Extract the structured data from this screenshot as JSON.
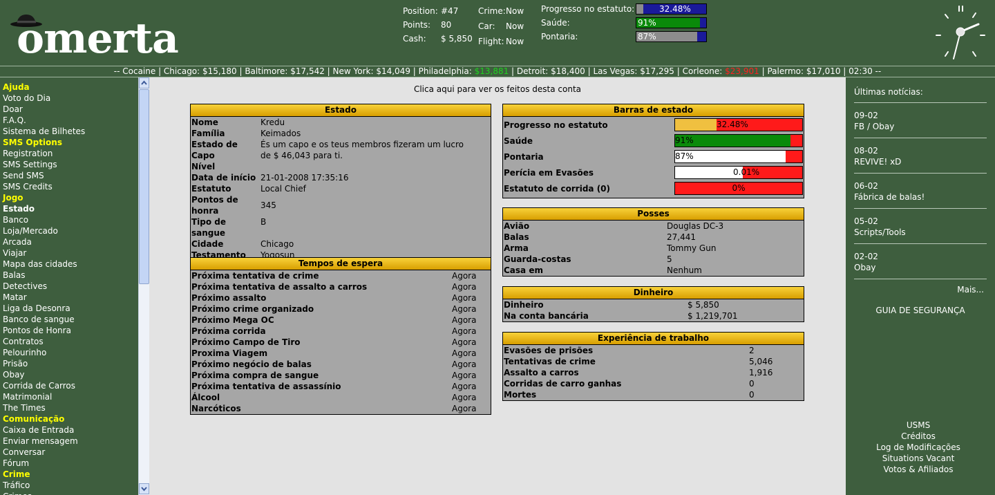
{
  "logo_text": "omerta",
  "header": {
    "position_label": "Position:",
    "position_value": "#47",
    "points_label": "Points:",
    "points_value": "80",
    "cash_label": "Cash:",
    "cash_value": "$ 5,850",
    "crime_label": "Crime:",
    "crime_value": "Now",
    "car_label": "Car:",
    "car_value": "Now",
    "flight_label": "Flight:",
    "flight_value": "Now",
    "progress_label": "Progresso no estatuto:",
    "progress_text": "32.48%",
    "progress_pct": 32.48,
    "health_label": "Saúde:",
    "health_text": "91%",
    "health_pct": 91,
    "aim_label": "Pontaria:",
    "aim_text": "87%",
    "aim_pct": 87,
    "colors": {
      "bg": "#3e5e3e",
      "bar_bg": "#1a1a9a",
      "bar_gray": "#8c8c8c",
      "bar_green": "#0a8a0a"
    }
  },
  "ticker": [
    {
      "t": "-- Cocaine | Chicago: ",
      "c": ""
    },
    {
      "t": "$15,180",
      "c": ""
    },
    {
      "t": " | Baltimore: ",
      "c": ""
    },
    {
      "t": "$17,542",
      "c": ""
    },
    {
      "t": " | New York: ",
      "c": ""
    },
    {
      "t": "$14,049",
      "c": ""
    },
    {
      "t": " | Philadelphia: ",
      "c": ""
    },
    {
      "t": "$13,881",
      "c": "up"
    },
    {
      "t": " | Detroit: ",
      "c": ""
    },
    {
      "t": "$18,400",
      "c": ""
    },
    {
      "t": " | Las Vegas: ",
      "c": ""
    },
    {
      "t": "$17,295",
      "c": ""
    },
    {
      "t": " | Corleone: ",
      "c": ""
    },
    {
      "t": "$23,901",
      "c": "dn"
    },
    {
      "t": " | Palermo: ",
      "c": ""
    },
    {
      "t": "$17,010",
      "c": ""
    },
    {
      "t": " | 02:30 --",
      "c": ""
    }
  ],
  "menu": [
    {
      "label": "Ajuda",
      "type": "sec"
    },
    {
      "label": "Voto do Dia",
      "type": ""
    },
    {
      "label": "Doar",
      "type": ""
    },
    {
      "label": "F.A.Q.",
      "type": ""
    },
    {
      "label": "Sistema de Bilhetes",
      "type": ""
    },
    {
      "label": "SMS Options",
      "type": "sec"
    },
    {
      "label": "Registration",
      "type": ""
    },
    {
      "label": "SMS Settings",
      "type": ""
    },
    {
      "label": "Send SMS",
      "type": ""
    },
    {
      "label": "SMS Credits",
      "type": ""
    },
    {
      "label": "Jogo",
      "type": "sec"
    },
    {
      "label": "Estado",
      "type": "cur"
    },
    {
      "label": "Banco",
      "type": ""
    },
    {
      "label": "Loja/Mercado",
      "type": ""
    },
    {
      "label": "Arcada",
      "type": ""
    },
    {
      "label": "Viajar",
      "type": ""
    },
    {
      "label": "Mapa das cidades",
      "type": ""
    },
    {
      "label": "Balas",
      "type": ""
    },
    {
      "label": "Detectives",
      "type": ""
    },
    {
      "label": "Matar",
      "type": ""
    },
    {
      "label": "Liga da Desonra",
      "type": ""
    },
    {
      "label": "Banco de sangue",
      "type": ""
    },
    {
      "label": "Pontos de Honra",
      "type": ""
    },
    {
      "label": "Contratos",
      "type": ""
    },
    {
      "label": "Pelourinho",
      "type": ""
    },
    {
      "label": "Prisão",
      "type": ""
    },
    {
      "label": "Obay",
      "type": ""
    },
    {
      "label": "Corrida de Carros",
      "type": ""
    },
    {
      "label": "Matrimonial",
      "type": ""
    },
    {
      "label": "The Times",
      "type": ""
    },
    {
      "label": "Comunicação",
      "type": "sec"
    },
    {
      "label": "Caixa de Entrada",
      "type": ""
    },
    {
      "label": "Enviar mensagem",
      "type": ""
    },
    {
      "label": "Conversar",
      "type": ""
    },
    {
      "label": "Fórum",
      "type": ""
    },
    {
      "label": "Crime",
      "type": "sec"
    },
    {
      "label": "Tráfico",
      "type": ""
    },
    {
      "label": "Crimes",
      "type": ""
    }
  ],
  "main_link": "Clica aqui para ver os feitos desta conta",
  "estado": {
    "title": "Estado",
    "rows": [
      {
        "k": "Nome",
        "v": "Kredu"
      },
      {
        "k": "Família",
        "v": "Keimados"
      },
      {
        "k": "Estado de Capo",
        "v": "És um capo e os teus membros fizeram um lucro de $ 46,043 para ti."
      },
      {
        "k": "Nível",
        "v": ""
      },
      {
        "k": "Data de início",
        "v": "21-01-2008 17:35:16"
      },
      {
        "k": "Estatuto",
        "v": "Local Chief"
      },
      {
        "k": "Pontos de honra",
        "v": "345"
      },
      {
        "k": "Tipo de sangue",
        "v": "B"
      },
      {
        "k": "Cidade",
        "v": "Chicago"
      },
      {
        "k": "Testamento",
        "v": "Yogosun"
      }
    ]
  },
  "tempos": {
    "title": "Tempos de espera",
    "rows": [
      {
        "k": "Próxima tentativa de crime",
        "v": "Agora"
      },
      {
        "k": "Próxima tentativa de assalto a carros",
        "v": "Agora"
      },
      {
        "k": "Próximo assalto",
        "v": "Agora"
      },
      {
        "k": "Próximo crime organizado",
        "v": "Agora"
      },
      {
        "k": "Próximo Mega OC",
        "v": "Agora"
      },
      {
        "k": "Próxima corrida",
        "v": "Agora"
      },
      {
        "k": "Próximo Campo de Tiro",
        "v": "Agora"
      },
      {
        "k": "Proxima Viagem",
        "v": "Agora"
      },
      {
        "k": "Próximo negócio de balas",
        "v": "Agora"
      },
      {
        "k": "Próxima compra de sangue",
        "v": "Agora"
      },
      {
        "k": "Próxima tentativa de assassínio",
        "v": "Agora"
      },
      {
        "k": "Álcool",
        "v": "Agora"
      },
      {
        "k": "Narcóticos",
        "v": "Agora"
      }
    ]
  },
  "barras": {
    "title": "Barras de estado",
    "rows": [
      {
        "k": "Progresso no estatuto",
        "text": "32.48%",
        "pct": 32.48,
        "color": "#f0c040"
      },
      {
        "k": "Saúde",
        "text": "91%",
        "pct": 91,
        "color": "#0a8a0a"
      },
      {
        "k": "Pontaria",
        "text": "87%",
        "pct": 87,
        "color": "#ffffff"
      },
      {
        "k": "Perícia em Evasões",
        "text": "0.01%",
        "pct": 53,
        "color": "#ffffff"
      },
      {
        "k": "Estatuto de corrida (0)",
        "text": "0%",
        "pct": 0,
        "color": "#ffffff"
      }
    ]
  },
  "posses": {
    "title": "Posses",
    "rows": [
      {
        "k": "Avião",
        "v": "Douglas DC-3"
      },
      {
        "k": "Balas",
        "v": "27,441"
      },
      {
        "k": "Arma",
        "v": "Tommy Gun"
      },
      {
        "k": "Guarda-costas",
        "v": "5"
      },
      {
        "k": "Casa em",
        "v": "Nenhum"
      }
    ]
  },
  "dinheiro": {
    "title": "Dinheiro",
    "rows": [
      {
        "k": "Dinheiro",
        "v": "$ 5,850"
      },
      {
        "k": "Na conta bancária",
        "v": "$ 1,219,701"
      }
    ]
  },
  "experiencia": {
    "title": "Experiência de trabalho",
    "rows": [
      {
        "k": "Evasões de prisões",
        "v": "2"
      },
      {
        "k": "Tentativas de crime",
        "v": "5,046"
      },
      {
        "k": "Assalto a carros",
        "v": "1,916"
      },
      {
        "k": "Corridas de carro ganhas",
        "v": "0"
      },
      {
        "k": "Mortes",
        "v": "0"
      }
    ]
  },
  "news": {
    "title": "Últimas notícias:",
    "items": [
      {
        "date": "09-02",
        "title": "FB / Obay"
      },
      {
        "date": "08-02",
        "title": "REVIVE! xD"
      },
      {
        "date": "06-02",
        "title": "Fábrica de balas!"
      },
      {
        "date": "05-02",
        "title": "Scripts/Tools"
      },
      {
        "date": "02-02",
        "title": "Obay"
      }
    ],
    "more": "Mais...",
    "guide": "GUIA DE SEGURANÇA"
  },
  "footer_links": [
    "USMS",
    "Créditos",
    "Log de Modificações",
    "Situations Vacant",
    "Votos & Afiliados"
  ]
}
